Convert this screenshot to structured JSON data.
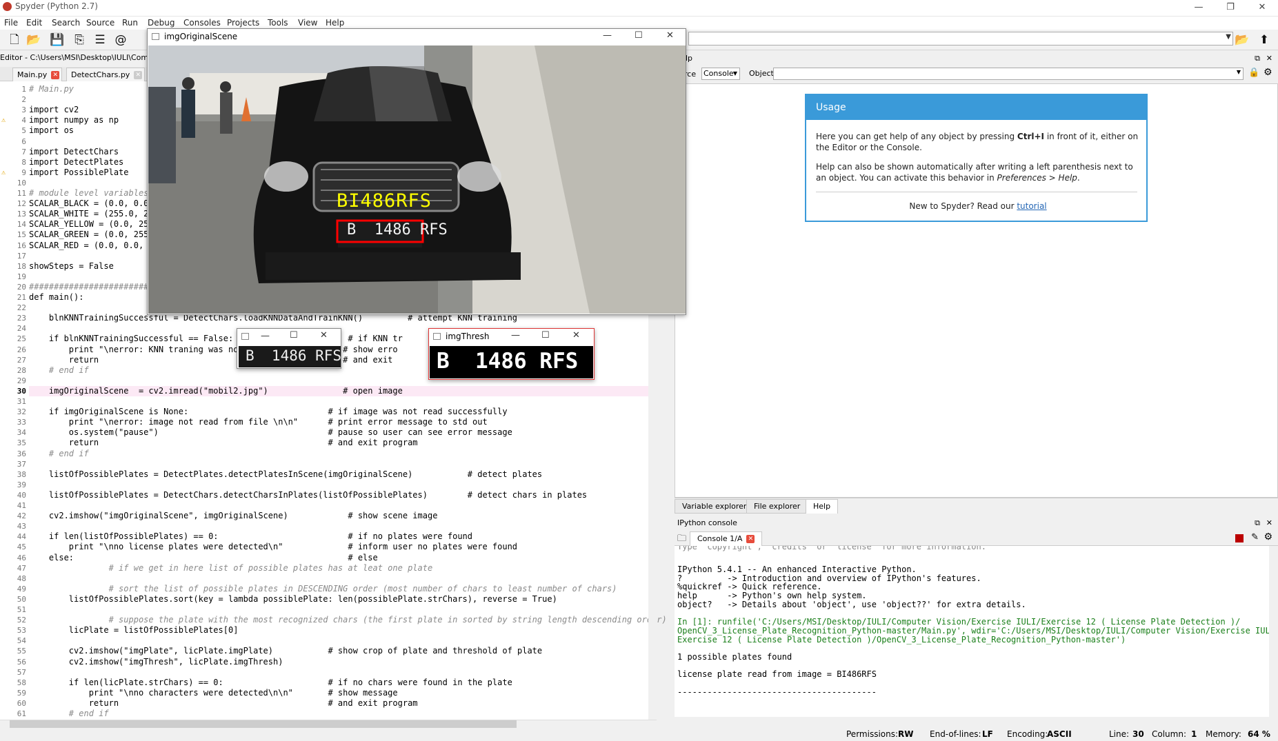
{
  "app": {
    "title": "Spyder (Python 2.7)",
    "menu": [
      "File",
      "Edit",
      "Search",
      "Source",
      "Run",
      "Debug",
      "Consoles",
      "Projects",
      "Tools",
      "View",
      "Help"
    ]
  },
  "editor": {
    "header": "Editor - C:\\Users\\MSI\\Desktop\\IULI\\Comput",
    "tabs": [
      "Main.py",
      "DetectChars.py"
    ],
    "lines": [
      {
        "n": "1",
        "t": "# Main.py",
        "c": "comment"
      },
      {
        "n": "2",
        "t": ""
      },
      {
        "n": "3",
        "t": "import cv2"
      },
      {
        "n": "4",
        "t": "import numpy as np",
        "warn": true
      },
      {
        "n": "5",
        "t": "import os"
      },
      {
        "n": "6",
        "t": ""
      },
      {
        "n": "7",
        "t": "import DetectChars"
      },
      {
        "n": "8",
        "t": "import DetectPlates"
      },
      {
        "n": "9",
        "t": "import PossiblePlate",
        "warn": true
      },
      {
        "n": "10",
        "t": ""
      },
      {
        "n": "11",
        "t": "# module level variables",
        "c": "comment"
      },
      {
        "n": "12",
        "t": "SCALAR_BLACK = (0.0, 0.0,"
      },
      {
        "n": "13",
        "t": "SCALAR_WHITE = (255.0, 25"
      },
      {
        "n": "14",
        "t": "SCALAR_YELLOW = (0.0, 255"
      },
      {
        "n": "15",
        "t": "SCALAR_GREEN = (0.0, 255."
      },
      {
        "n": "16",
        "t": "SCALAR_RED = (0.0, 0.0, 2"
      },
      {
        "n": "17",
        "t": ""
      },
      {
        "n": "18",
        "t": "showSteps = False"
      },
      {
        "n": "19",
        "t": ""
      },
      {
        "n": "20",
        "t": "###########################",
        "c": "comment"
      },
      {
        "n": "21",
        "t": "def main():"
      },
      {
        "n": "22",
        "t": ""
      },
      {
        "n": "23",
        "t": "    blnKNNTrainingSuccessful = DetectChars.loadKNNDataAndTrainKNN()         # attempt KNN training"
      },
      {
        "n": "24",
        "t": ""
      },
      {
        "n": "25",
        "t": "    if blnKNNTrainingSuccessful == False:                       # if KNN tr"
      },
      {
        "n": "26",
        "t": "        print \"\\nerror: KNN traning was not                    # show erro"
      },
      {
        "n": "27",
        "t": "        return                                                 # and exit"
      },
      {
        "n": "28",
        "t": "    # end if",
        "c": "comment"
      },
      {
        "n": "29",
        "t": ""
      },
      {
        "n": "30",
        "t": "    imgOriginalScene  = cv2.imread(\"mobil2.jpg\")               # open image",
        "cur": true
      },
      {
        "n": "31",
        "t": ""
      },
      {
        "n": "32",
        "t": "    if imgOriginalScene is None:                            # if image was not read successfully"
      },
      {
        "n": "33",
        "t": "        print \"\\nerror: image not read from file \\n\\n\"      # print error message to std out"
      },
      {
        "n": "34",
        "t": "        os.system(\"pause\")                                  # pause so user can see error message"
      },
      {
        "n": "35",
        "t": "        return                                              # and exit program"
      },
      {
        "n": "36",
        "t": "    # end if",
        "c": "comment"
      },
      {
        "n": "37",
        "t": ""
      },
      {
        "n": "38",
        "t": "    listOfPossiblePlates = DetectPlates.detectPlatesInScene(imgOriginalScene)           # detect plates"
      },
      {
        "n": "39",
        "t": ""
      },
      {
        "n": "40",
        "t": "    listOfPossiblePlates = DetectChars.detectCharsInPlates(listOfPossiblePlates)        # detect chars in plates"
      },
      {
        "n": "41",
        "t": ""
      },
      {
        "n": "42",
        "t": "    cv2.imshow(\"imgOriginalScene\", imgOriginalScene)            # show scene image"
      },
      {
        "n": "43",
        "t": ""
      },
      {
        "n": "44",
        "t": "    if len(listOfPossiblePlates) == 0:                          # if no plates were found"
      },
      {
        "n": "45",
        "t": "        print \"\\nno license plates were detected\\n\"             # inform user no plates were found"
      },
      {
        "n": "46",
        "t": "    else:                                                       # else"
      },
      {
        "n": "47",
        "t": "                # if we get in here list of possible plates has at leat one plate",
        "c": "comment"
      },
      {
        "n": "48",
        "t": ""
      },
      {
        "n": "49",
        "t": "                # sort the list of possible plates in DESCENDING order (most number of chars to least number of chars)",
        "c": "comment"
      },
      {
        "n": "50",
        "t": "        listOfPossiblePlates.sort(key = lambda possiblePlate: len(possiblePlate.strChars), reverse = True)"
      },
      {
        "n": "51",
        "t": ""
      },
      {
        "n": "52",
        "t": "                # suppose the plate with the most recognized chars (the first plate in sorted by string length descending order)",
        "c": "comment"
      },
      {
        "n": "53",
        "t": "        licPlate = listOfPossiblePlates[0]"
      },
      {
        "n": "54",
        "t": ""
      },
      {
        "n": "55",
        "t": "        cv2.imshow(\"imgPlate\", licPlate.imgPlate)           # show crop of plate and threshold of plate"
      },
      {
        "n": "56",
        "t": "        cv2.imshow(\"imgThresh\", licPlate.imgThresh)"
      },
      {
        "n": "57",
        "t": ""
      },
      {
        "n": "58",
        "t": "        if len(licPlate.strChars) == 0:                     # if no chars were found in the plate"
      },
      {
        "n": "59",
        "t": "            print \"\\nno characters were detected\\n\\n\"       # show message"
      },
      {
        "n": "60",
        "t": "            return                                          # and exit program"
      },
      {
        "n": "61",
        "t": "        # end if",
        "c": "comment"
      }
    ]
  },
  "help": {
    "source_label": "rce",
    "source_value": "Console",
    "object_label": "Object",
    "usage_title": "Usage",
    "usage_p1a": "Here you can get help of any object by pressing ",
    "usage_p1b": "Ctrl+I",
    "usage_p1c": " in front of it, either on the Editor or the Console.",
    "usage_p2a": "Help can also be shown automatically after writing a left parenthesis next to an object. You can activate this behavior in ",
    "usage_p2b": "Preferences > Help",
    "usage_p2c": ".",
    "usage_p3a": "New to Spyder? Read our ",
    "usage_p3b": "tutorial",
    "tabs": [
      "Variable explorer",
      "File explorer",
      "Help"
    ],
    "pane_title": "lp"
  },
  "console": {
    "title": "IPython console",
    "tab": "Console 1/A",
    "lines": [
      {
        "t": "IPython 5.4.1 -- An enhanced Interactive Python."
      },
      {
        "t": "?         -> Introduction and overview of IPython's features."
      },
      {
        "t": "%quickref -> Quick reference."
      },
      {
        "t": "help      -> Python's own help system."
      },
      {
        "t": "object?   -> Details about 'object', use 'object??' for extra details."
      },
      {
        "t": ""
      },
      {
        "t": "In [1]: runfile('C:/Users/MSI/Desktop/IULI/Computer Vision/Exercise IULI/Exercise 12 ( License Plate Detection )/",
        "c": "in"
      },
      {
        "t": "OpenCV_3_License_Plate_Recognition_Python-master/Main.py', wdir='C:/Users/MSI/Desktop/IULI/Computer Vision/Exercise IULI/",
        "c": "in"
      },
      {
        "t": "Exercise 12 ( License Plate Detection )/OpenCV_3_License_Plate_Recognition_Python-master')",
        "c": "in"
      },
      {
        "t": ""
      },
      {
        "t": "1 possible plates found"
      },
      {
        "t": ""
      },
      {
        "t": "license plate read from image = BI486RFS"
      },
      {
        "t": ""
      },
      {
        "t": "----------------------------------------"
      }
    ]
  },
  "status": {
    "perm_label": "Permissions:",
    "perm": "RW",
    "eol_label": "End-of-lines:",
    "eol": "LF",
    "enc_label": "Encoding:",
    "enc": "ASCII",
    "line_label": "Line:",
    "line": "30",
    "col_label": "Column:",
    "col": "1",
    "mem_label": "Memory:",
    "mem": "64 %"
  },
  "windows": {
    "scene_title": "imgOriginalScene",
    "scene_text": "BI486RFS",
    "plate_text": "B  1486 RFS",
    "thresh_title": "imgThresh",
    "thresh_text": "B  1486 RFS",
    "plate_win_text": "B  1486 RFS"
  },
  "colors": {
    "accent": "#3a9ad9",
    "overlay_text": "#ffff00",
    "overlay_box": "#ff0000"
  }
}
